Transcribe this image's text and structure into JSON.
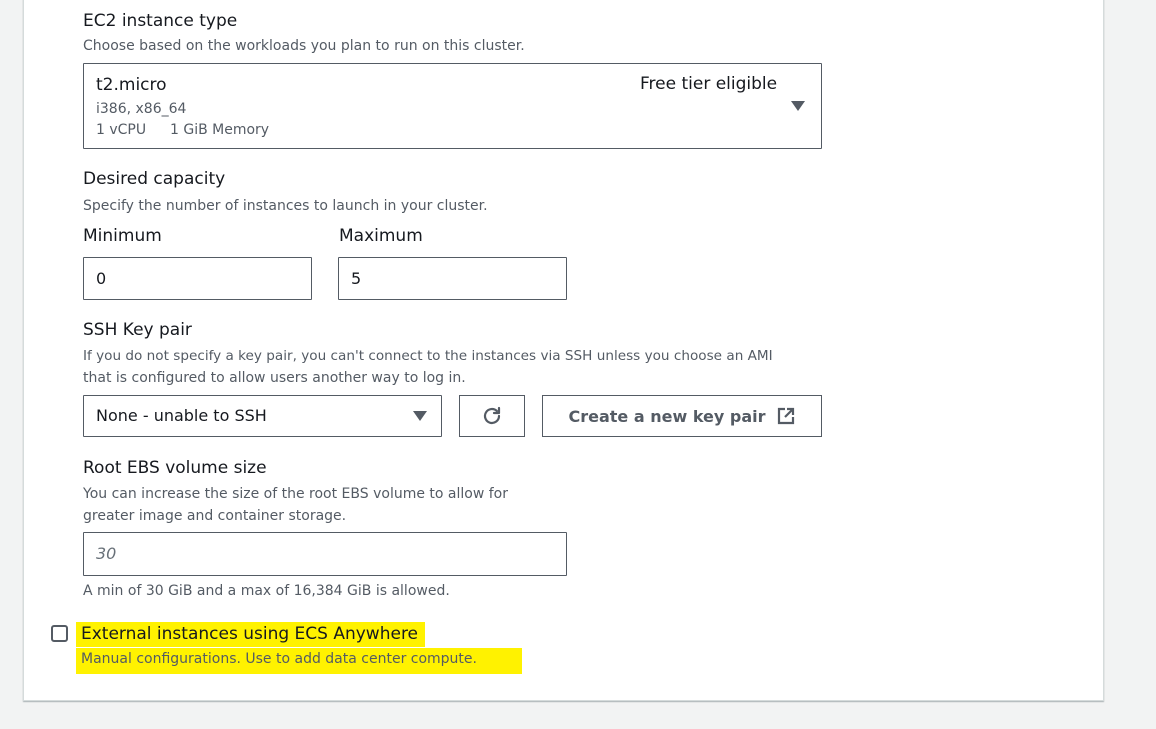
{
  "instance_type": {
    "label": "EC2 instance type",
    "description": "Choose based on the workloads you plan to run on this cluster.",
    "selected_name": "t2.micro",
    "selected_badge": "Free tier eligible",
    "selected_arch": "i386, x86_64",
    "selected_vcpu": "1 vCPU",
    "selected_memory": "1 GiB Memory"
  },
  "capacity": {
    "label": "Desired capacity",
    "description": "Specify the number of instances to launch in your cluster.",
    "min_label": "Minimum",
    "min_value": "0",
    "max_label": "Maximum",
    "max_value": "5"
  },
  "ssh": {
    "label": "SSH Key pair",
    "description_line1": "If you do not specify a key pair, you can't connect to the instances via SSH unless you choose an AMI",
    "description_line2": "that is configured to allow users another way to log in.",
    "selected": "None - unable to SSH",
    "create_button": "Create a new key pair"
  },
  "ebs": {
    "label": "Root EBS volume size",
    "description_line1": "You can increase the size of the root EBS volume to allow for",
    "description_line2": "greater image and container storage.",
    "placeholder": "30",
    "hint": "A min of 30 GiB and a max of 16,384 GiB is allowed."
  },
  "external": {
    "label": "External instances using ECS Anywhere",
    "description": "Manual configurations. Use to add data center compute.",
    "checked": false,
    "highlight_color": "#fff200"
  }
}
